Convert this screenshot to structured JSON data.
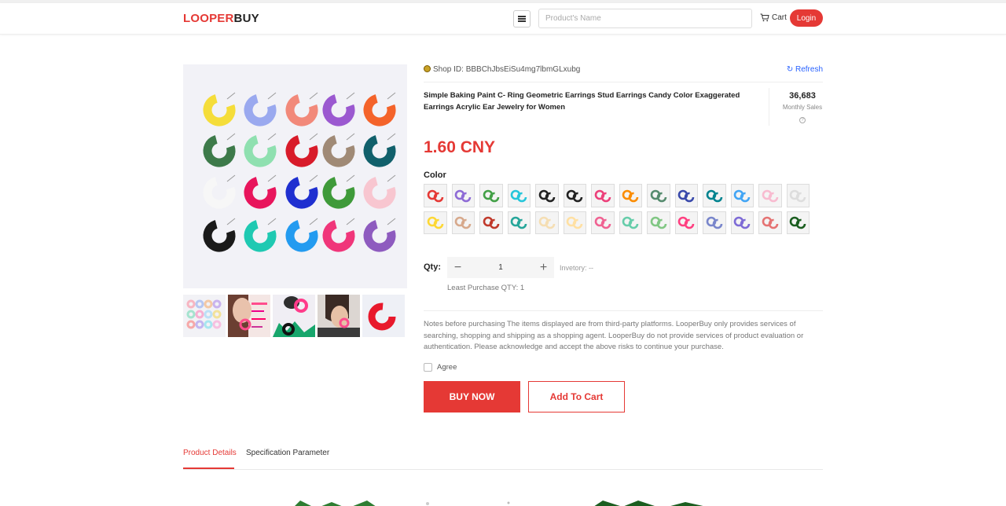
{
  "header": {
    "logo_part1": "LOOPER",
    "logo_part2": "BUY",
    "search_placeholder": "Product's Name",
    "cart_label": "Cart",
    "login_label": "Login"
  },
  "product": {
    "shop_id": "Shop ID: BBBChJbsEiSu4mg7lbmGLxubg",
    "refresh_label": "Refresh",
    "title": "Simple Baking Paint C- Ring Geometric Earrings Stud Earrings Candy Color Exaggerated Earrings Acrylic Ear Jewelry for Women",
    "monthly_sales_value": "36,683",
    "monthly_sales_label": "Monthly Sales",
    "price": "1.60 CNY",
    "color_label": "Color",
    "swatch_colors": [
      "#e53935",
      "#8e6bd6",
      "#43a047",
      "#26c6da",
      "#222222",
      "#222222",
      "#ec407a",
      "#fb8c00",
      "#558b6e",
      "#3949ab",
      "#00838f",
      "#42a5f5",
      "#f8bbd0",
      "#dddddd",
      "#fdd835",
      "#d7a98c",
      "#c0392b",
      "#26a69a",
      "#f5deb3",
      "#ffe0a3",
      "#f06292",
      "#66cdaa",
      "#81c784",
      "#ff4081",
      "#7986cb",
      "#7e6bd6",
      "#e57373",
      "#1b5e20"
    ],
    "qty_label": "Qty:",
    "qty_value": "1",
    "inventory": "Invetory: --",
    "least_purchase": "Least Purchase QTY: 1",
    "notes": "Notes before purchasing The items displayed are from third-party platforms. LooperBuy only provides services of searching, shopping and shipping as a shopping agent. LooperBuy do not provide services of product evaluation or authentication. Please acknowledge and accept the above risks to continue your purchase.",
    "agree_label": "Agree",
    "buy_now_label": "BUY NOW",
    "add_to_cart_label": "Add To Cart"
  },
  "gallery": {
    "main_hoop_colors": [
      "#f5dd3a",
      "#9aa9ef",
      "#f2897a",
      "#9b59d0",
      "#f4632a",
      "#3d7a4a",
      "#8fe0b0",
      "#d81b2a",
      "#a08a76",
      "#11606b",
      "#f7f7f7",
      "#e8155c",
      "#1f2fd0",
      "#3f9a3a",
      "#f8c6d0",
      "#1a1a1a",
      "#1fc9b2",
      "#239bf0",
      "#f0367a",
      "#8e5bbf"
    ],
    "thumbnail_count": 5
  },
  "tabs": [
    {
      "label": "Product Details"
    },
    {
      "label": "Specification Parameter"
    }
  ]
}
